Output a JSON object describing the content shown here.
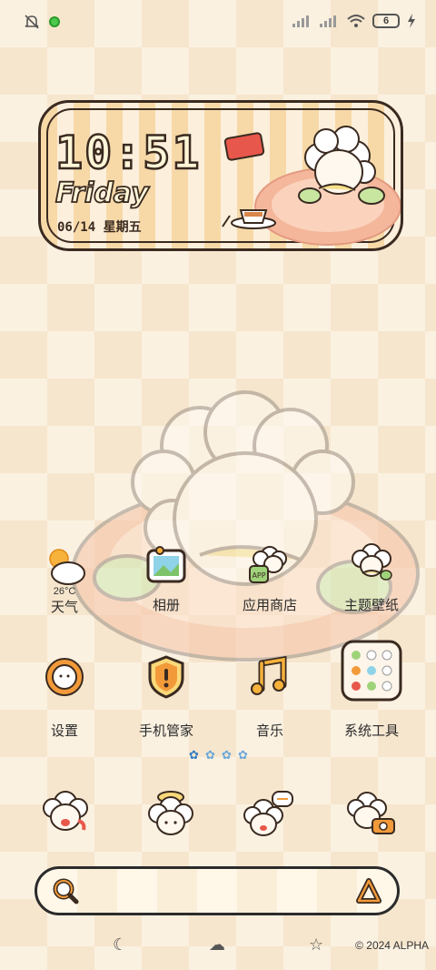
{
  "status_bar": {
    "battery": "6",
    "icons": [
      "mute-bell-icon",
      "notification-dot-icon",
      "signal-icon",
      "signal-icon",
      "wifi-icon",
      "battery-icon",
      "charging-icon"
    ]
  },
  "widget": {
    "time": "10:51",
    "day": "Friday",
    "date": "06/14  星期五"
  },
  "apps": [
    {
      "label": "天气",
      "temp": "26°C",
      "icon": "weather-icon"
    },
    {
      "label": "相册",
      "icon": "gallery-icon"
    },
    {
      "label": "应用商店",
      "icon": "app-store-icon"
    },
    {
      "label": "主题壁纸",
      "icon": "theme-icon"
    },
    {
      "label": "设置",
      "icon": "settings-icon"
    },
    {
      "label": "手机管家",
      "icon": "security-icon"
    },
    {
      "label": "音乐",
      "icon": "music-icon"
    },
    {
      "label": "系统工具",
      "icon": "folder-icon"
    }
  ],
  "page_indicator": {
    "count": 4,
    "active": 0
  },
  "dock": [
    "phone-sheep-icon",
    "camera-sheep-icon",
    "message-sheep-icon",
    "browser-sheep-icon"
  ],
  "search": {
    "icons": [
      "search-icon",
      "assistant-icon"
    ]
  },
  "nav": {
    "icons": [
      "back-icon",
      "home-icon",
      "recents-icon"
    ]
  },
  "copyright": "© 2024 ALPHA"
}
